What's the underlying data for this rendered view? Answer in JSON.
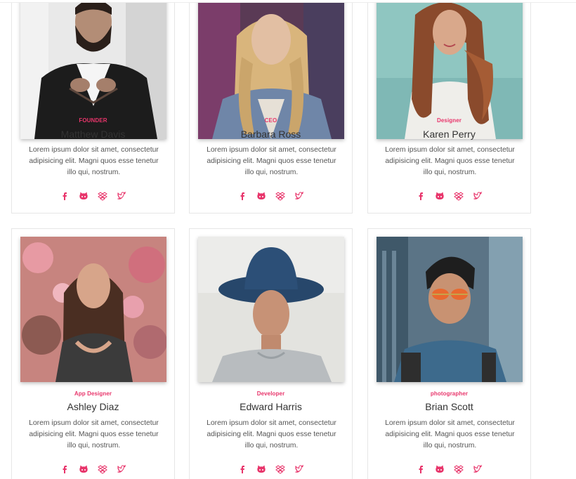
{
  "accent_color": "#e8356b",
  "social_icons": [
    "facebook-icon",
    "github-icon",
    "dropbox-icon",
    "twitter-icon"
  ],
  "team": [
    {
      "role": "FOUNDER",
      "name": "Matthew Davis",
      "bio": "Lorem ipsum dolor sit amet, consectetur adipisicing elit. Magni quos esse tenetur illo qui, nostrum."
    },
    {
      "role": "CEO",
      "name": "Barbara Ross",
      "bio": "Lorem ipsum dolor sit amet, consectetur adipisicing elit. Magni quos esse tenetur illo qui, nostrum."
    },
    {
      "role": "Designer",
      "name": "Karen Perry",
      "bio": "Lorem ipsum dolor sit amet, consectetur adipisicing elit. Magni quos esse tenetur illo qui, nostrum."
    },
    {
      "role": "App Designer",
      "name": "Ashley Diaz",
      "bio": "Lorem ipsum dolor sit amet, consectetur adipisicing elit. Magni quos esse tenetur illo qui, nostrum."
    },
    {
      "role": "Developer",
      "name": "Edward Harris",
      "bio": "Lorem ipsum dolor sit amet, consectetur adipisicing elit. Magni quos esse tenetur illo qui, nostrum."
    },
    {
      "role": "photographer",
      "name": "Brian Scott",
      "bio": "Lorem ipsum dolor sit amet, consectetur adipisicing elit. Magni quos esse tenetur illo qui, nostrum."
    }
  ]
}
